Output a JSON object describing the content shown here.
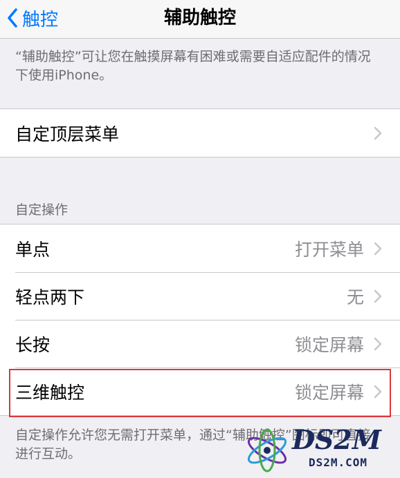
{
  "nav": {
    "back_label": "触控",
    "title": "辅助触控"
  },
  "intro_note": "“辅助触控”可让您在触摸屏幕有困难或需要自适应配件的情况下使用iPhone。",
  "top_menu": {
    "label": "自定顶层菜单"
  },
  "custom_actions": {
    "header": "自定操作",
    "items": [
      {
        "label": "单点",
        "value": "打开菜单"
      },
      {
        "label": "轻点两下",
        "value": "无"
      },
      {
        "label": "长按",
        "value": "锁定屏幕"
      },
      {
        "label": "三维触控",
        "value": "锁定屏幕"
      }
    ]
  },
  "actions_note": "自定操作允许您无需打开菜单，通过“辅助触控”图标即可直接进行互动。",
  "watermark": {
    "brand": "DS2M",
    "domain": "DS2M.COM"
  },
  "colors": {
    "accent": "#007aff",
    "highlight": "#d9383e",
    "background": "#efeff4"
  }
}
